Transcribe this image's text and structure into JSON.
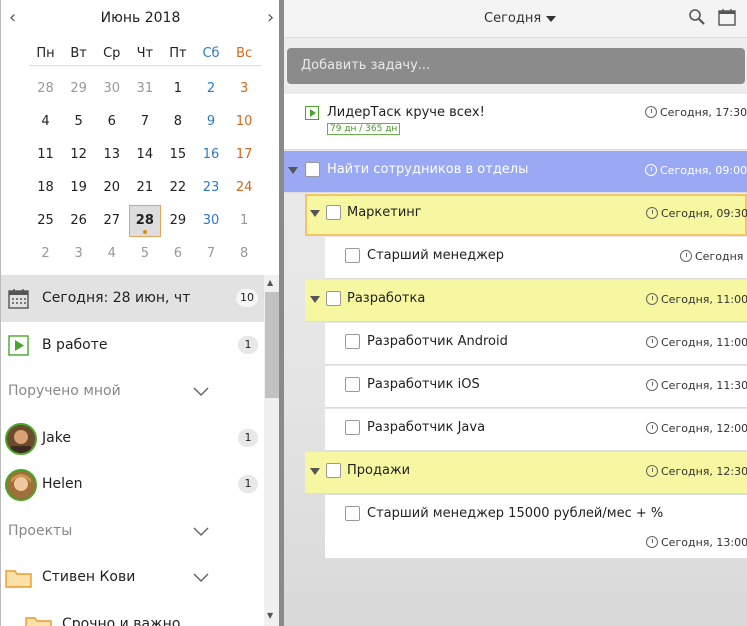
{
  "calendar": {
    "title": "Июнь 2018",
    "prev_label": "‹",
    "next_label": "›",
    "weekdays": [
      "Пн",
      "Вт",
      "Ср",
      "Чт",
      "Пт",
      "Сб",
      "Вс"
    ],
    "weeks": [
      [
        "28",
        "29",
        "30",
        "31",
        "1",
        "2",
        "3"
      ],
      [
        "4",
        "5",
        "6",
        "7",
        "8",
        "9",
        "10"
      ],
      [
        "11",
        "12",
        "13",
        "14",
        "15",
        "16",
        "17"
      ],
      [
        "18",
        "19",
        "20",
        "21",
        "22",
        "23",
        "24"
      ],
      [
        "25",
        "26",
        "27",
        "28",
        "29",
        "30",
        "1"
      ],
      [
        "2",
        "3",
        "4",
        "5",
        "6",
        "7",
        "8"
      ]
    ],
    "today": "28"
  },
  "nav": {
    "today_label": "Сегодня: 28 июн, чт",
    "today_count": "10",
    "in_work_label": "В работе",
    "in_work_count": "1",
    "assigned_label": "Поручено мной",
    "users": [
      {
        "name": "Jake",
        "count": "1"
      },
      {
        "name": "Helen",
        "count": "1"
      }
    ],
    "projects_label": "Проекты",
    "project_name": "Стивен Кови",
    "sub_project": "Срочно и важно"
  },
  "topbar": {
    "today_select": "Сегодня",
    "search_icon": "search-icon",
    "calendar_icon": "calendar-icon"
  },
  "add_task": {
    "placeholder": "Добавить задачу..."
  },
  "tasks": {
    "t1": {
      "title": "ЛидерТаск круче всех!",
      "time": "Сегодня, 17:30",
      "progress": "79 дн / 365 дн"
    },
    "t2": {
      "title": "Найти сотрудников в отделы",
      "time": "Сегодня, 09:00"
    },
    "t3": {
      "title": "Маркетинг",
      "time": "Сегодня, 09:30"
    },
    "t4": {
      "title": "Старший менеджер",
      "time": "Сегодня"
    },
    "t5": {
      "title": "Разработка",
      "time": "Сегодня, 11:00"
    },
    "t6": {
      "title": "Разработчик Android",
      "time": "Сегодня, 11:00"
    },
    "t7": {
      "title": "Разработчик iOS",
      "time": "Сегодня, 11:30"
    },
    "t8": {
      "title": "Разработчик Java",
      "time": "Сегодня, 12:00"
    },
    "t9": {
      "title": "Продажи",
      "time": "Сегодня, 12:30"
    },
    "t10": {
      "title": "Старший менеджер 15000 рублей/мес + %",
      "time": "Сегодня, 13:00"
    }
  },
  "colors": {
    "blue_row": "#9aa9f3",
    "yellow_row": "#f6f7a0",
    "selected_border": "#f5c469",
    "accent_green": "#4aa62b",
    "saturday": "#2b7bc8",
    "sunday": "#d2691e"
  }
}
